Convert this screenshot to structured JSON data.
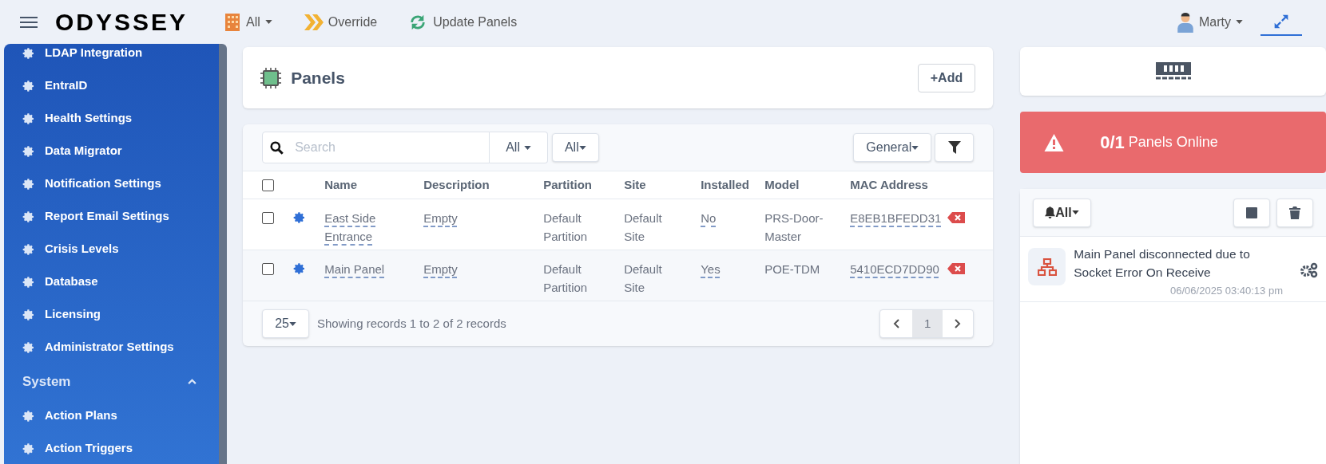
{
  "topbar": {
    "logo": "ODYSSEY",
    "site_filter": "All",
    "override": "Override",
    "update": "Update Panels",
    "user": "Marty"
  },
  "sidebar": {
    "items": [
      {
        "kind": "item",
        "label": "LDAP Integration"
      },
      {
        "kind": "item",
        "label": "EntraID"
      },
      {
        "kind": "item",
        "label": "Health Settings"
      },
      {
        "kind": "item",
        "label": "Data Migrator"
      },
      {
        "kind": "item",
        "label": "Notification Settings"
      },
      {
        "kind": "item",
        "label": "Report Email Settings"
      },
      {
        "kind": "item",
        "label": "Crisis Levels"
      },
      {
        "kind": "item",
        "label": "Database"
      },
      {
        "kind": "item",
        "label": "Licensing"
      },
      {
        "kind": "item",
        "label": "Administrator Settings"
      },
      {
        "kind": "section",
        "label": "System",
        "expanded": true
      },
      {
        "kind": "item",
        "label": "Action Plans"
      },
      {
        "kind": "item",
        "label": "Action Triggers"
      }
    ]
  },
  "panels": {
    "title": "Panels",
    "add": "+Add"
  },
  "toolbar": {
    "search": {
      "placeholder": "Search"
    },
    "filter_1": "All",
    "filter_2": "All",
    "view": "General"
  },
  "table": {
    "select_all_checked": false,
    "columns": [
      "Name",
      "Description",
      "Partition",
      "Site",
      "Installed",
      "Model",
      "MAC Address"
    ],
    "rows": [
      {
        "checked": false,
        "name": "East Side Entrance",
        "description": "Empty",
        "partition": "Default Partition",
        "site": "Default Site",
        "installed": "No",
        "model": "PRS-Door-Master",
        "mac": "E8EB1BFEDD31"
      },
      {
        "checked": false,
        "name": "Main Panel",
        "description": "Empty",
        "partition": "Default Partition",
        "site": "Default Site",
        "installed": "Yes",
        "model": "POE-TDM",
        "mac": "5410ECD7DD90"
      }
    ]
  },
  "footer": {
    "page_size": "25",
    "summary": "Showing records 1 to 2 of 2 records",
    "pages": [
      {
        "label": "1",
        "selected": true
      }
    ]
  },
  "status": {
    "count": "0/1",
    "label": "Panels Online"
  },
  "notifications": {
    "filter": "All",
    "items": [
      {
        "message": "Main Panel disconnected due to Socket Error On Receive",
        "time": "06/06/2025 03:40:13 pm"
      }
    ]
  }
}
